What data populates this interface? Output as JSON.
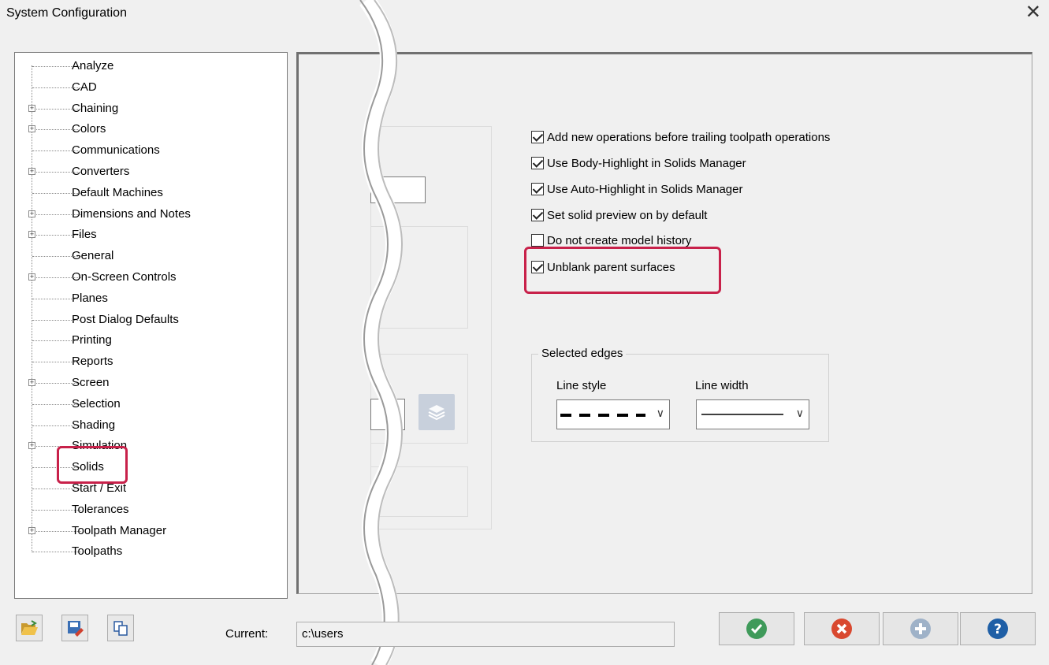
{
  "window": {
    "title": "System Configuration",
    "close_glyph": "✕"
  },
  "tree": {
    "selected": "Solids",
    "items": [
      {
        "label": "Analyze",
        "expandable": false
      },
      {
        "label": "CAD",
        "expandable": false
      },
      {
        "label": "Chaining",
        "expandable": true
      },
      {
        "label": "Colors",
        "expandable": true
      },
      {
        "label": "Communications",
        "expandable": false
      },
      {
        "label": "Converters",
        "expandable": true
      },
      {
        "label": "Default Machines",
        "expandable": false
      },
      {
        "label": "Dimensions and Notes",
        "expandable": true
      },
      {
        "label": "Files",
        "expandable": true
      },
      {
        "label": "General",
        "expandable": false
      },
      {
        "label": "On-Screen Controls",
        "expandable": true
      },
      {
        "label": "Planes",
        "expandable": false
      },
      {
        "label": "Post Dialog Defaults",
        "expandable": false
      },
      {
        "label": "Printing",
        "expandable": false
      },
      {
        "label": "Reports",
        "expandable": false
      },
      {
        "label": "Screen",
        "expandable": true
      },
      {
        "label": "Selection",
        "expandable": false
      },
      {
        "label": "Shading",
        "expandable": false
      },
      {
        "label": "Simulation",
        "expandable": true
      },
      {
        "label": "Solids",
        "expandable": false
      },
      {
        "label": "Start / Exit",
        "expandable": false
      },
      {
        "label": "Tolerances",
        "expandable": false
      },
      {
        "label": "Toolpath Manager",
        "expandable": true
      },
      {
        "label": "Toolpaths",
        "expandable": false
      }
    ]
  },
  "options": {
    "checkboxes": [
      {
        "label": "Add new operations before trailing toolpath operations",
        "checked": true
      },
      {
        "label": "Use Body-Highlight in Solids Manager",
        "checked": true
      },
      {
        "label": "Use Auto-Highlight in Solids Manager",
        "checked": true
      },
      {
        "label": "Set solid preview on by default",
        "checked": true
      },
      {
        "label": "Do not create model history",
        "checked": false
      },
      {
        "label": "Unblank parent surfaces",
        "checked": true
      }
    ]
  },
  "selected_edges": {
    "group_label": "Selected edges",
    "line_style_label": "Line style",
    "line_width_label": "Line width",
    "line_style_value": "dashed",
    "line_width_value": "thin"
  },
  "footer": {
    "current_label": "Current:",
    "current_value": "c:\\users",
    "buttons": [
      "ok",
      "cancel",
      "add",
      "help"
    ]
  },
  "colors": {
    "highlight": "#c8214a",
    "ok": "#3f9a5a",
    "cancel": "#d9482f",
    "add_disabled": "#9fb2c8",
    "help": "#1f5fa6"
  }
}
